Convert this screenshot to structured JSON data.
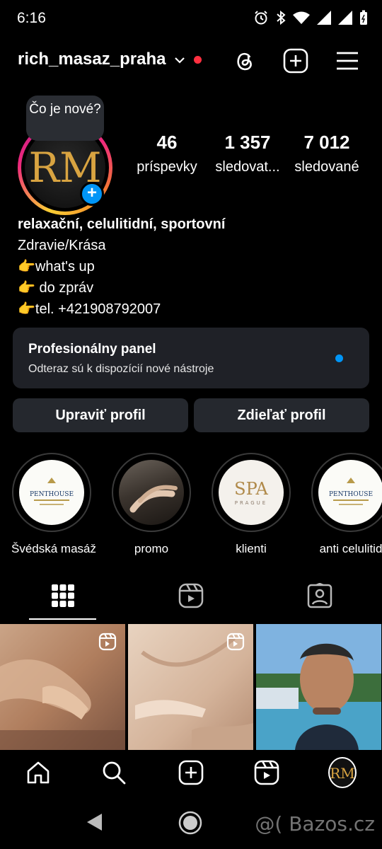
{
  "status": {
    "time": "6:16"
  },
  "header": {
    "username": "rich_masaz_praha",
    "chevron": "⌄"
  },
  "profile": {
    "avatar_initials": "RM",
    "whats_new": "Čo je nové?",
    "stats": [
      {
        "num": "46",
        "label": "príspevky"
      },
      {
        "num": "1 357",
        "label": "sledovat..."
      },
      {
        "num": "7 012",
        "label": "sledované"
      }
    ],
    "bio": [
      "relaxační, celulitidní, sportovní",
      "Zdravie/Krása",
      "👉what's up",
      "👉 do zpráv",
      "👉tel. +421908792007"
    ]
  },
  "panel": {
    "title": "Profesionálny panel",
    "subtitle": "Odteraz sú k dispozícií nové nástroje"
  },
  "buttons": {
    "edit": "Upraviť profil",
    "share": "Zdieľať profil"
  },
  "highlights": [
    {
      "label": "Švédská masáž",
      "art": "PENTHOUSE"
    },
    {
      "label": "promo",
      "art": ""
    },
    {
      "label": "klienti",
      "art": "SPA",
      "sub": "PRAGUE"
    },
    {
      "label": "anti celulitid",
      "art": "PENTHOUSE"
    }
  ],
  "watermark": "@( Bazos.cz",
  "colors": {
    "accent": "#0095f6",
    "notification": "#ff3040",
    "panel": "#1f2127",
    "button": "#25282e"
  }
}
